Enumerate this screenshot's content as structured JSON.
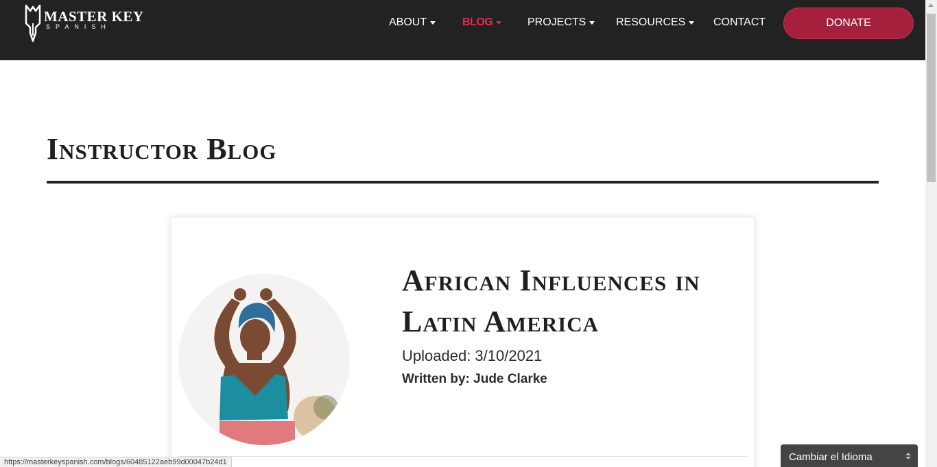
{
  "brand": {
    "title": "MASTER KEY",
    "subtitle": "SPANISH",
    "logo_icon": "key-icon"
  },
  "nav": {
    "items": [
      {
        "label": "ABOUT",
        "dropdown": true
      },
      {
        "label": "BLOG",
        "dropdown": true,
        "active": true
      },
      {
        "label": "PROJECTS",
        "dropdown": true
      },
      {
        "label": "RESOURCES",
        "dropdown": true
      },
      {
        "label": "CONTACT",
        "dropdown": false
      }
    ],
    "donate_label": "DONATE"
  },
  "page": {
    "title": "Instructor Blog"
  },
  "post": {
    "title": "African Influences in Latin America",
    "uploaded": "Uploaded: 3/10/2021",
    "author": "Written by: Jude Clarke"
  },
  "status_bar": {
    "url": "https://masterkeyspanish.com/blogs/60485122aeb99d00047b24d1"
  },
  "language_select": {
    "selected": "Cambiar el Idioma"
  },
  "colors": {
    "navbar_bg": "#222222",
    "accent_active": "#e8294e",
    "donate_bg": "#a4203c",
    "text_dark": "#1f1f1f"
  }
}
